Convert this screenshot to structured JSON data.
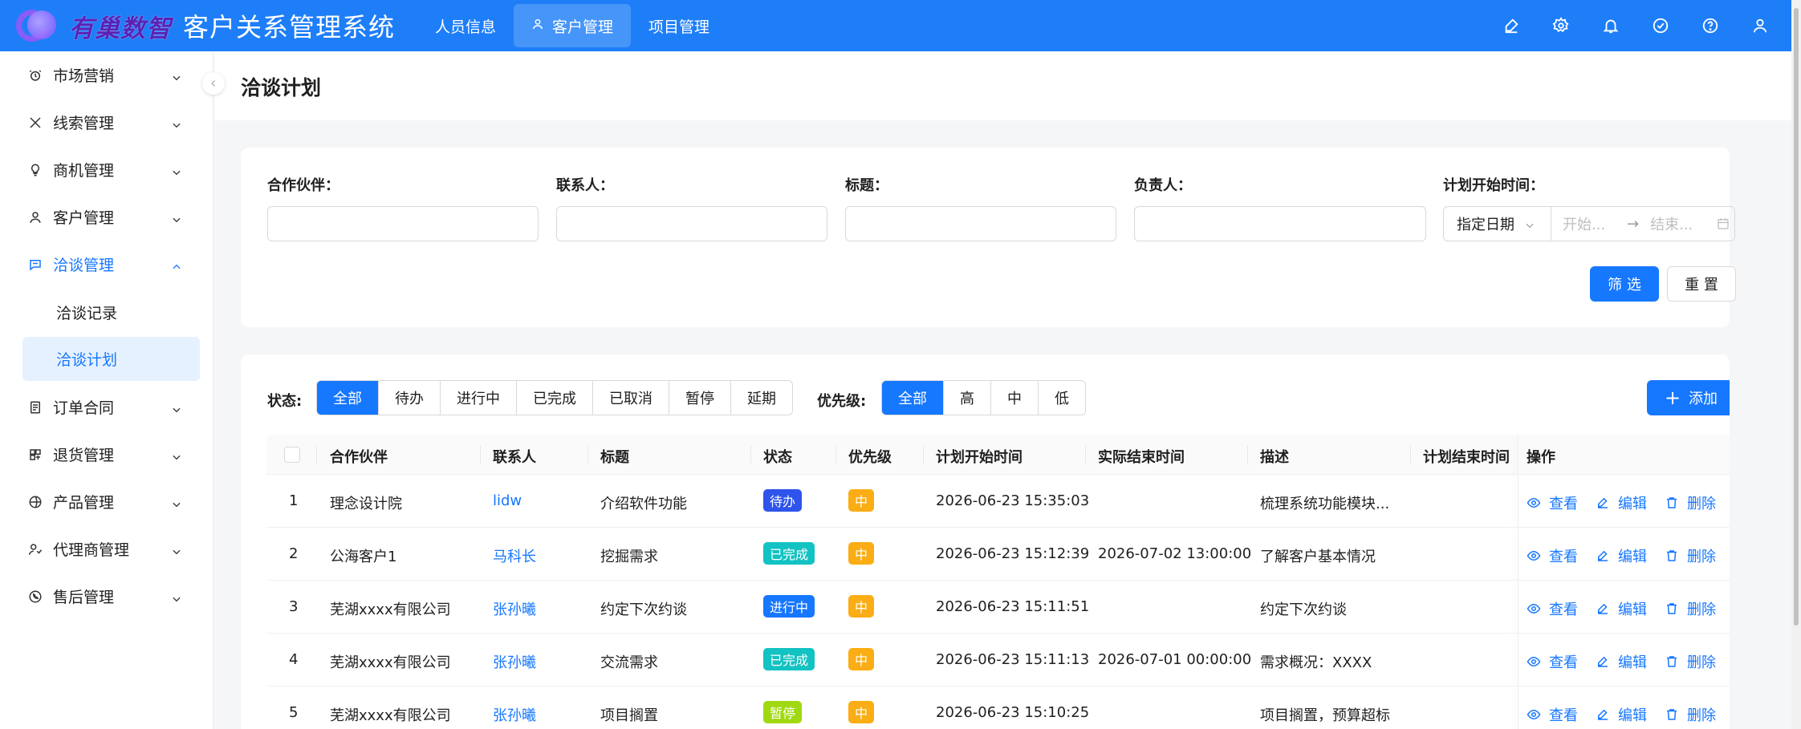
{
  "app": {
    "brand": "有巢数智",
    "title": "客户关系管理系统"
  },
  "topnav": [
    {
      "label": "人员信息",
      "icon": "",
      "active": false
    },
    {
      "label": "客户管理",
      "icon": "user-icon",
      "active": true
    },
    {
      "label": "项目管理",
      "icon": "",
      "active": false
    }
  ],
  "top_icons": [
    "brush-icon",
    "gear-icon",
    "bell-icon",
    "check-circle-icon",
    "help-icon",
    "user-icon"
  ],
  "sidebar": {
    "items": [
      {
        "label": "市场营销",
        "icon": "alarm-icon"
      },
      {
        "label": "线索管理",
        "icon": "x-icon"
      },
      {
        "label": "商机管理",
        "icon": "bulb-icon"
      },
      {
        "label": "客户管理",
        "icon": "user-icon"
      },
      {
        "label": "洽谈管理",
        "icon": "chat-icon",
        "open": true
      },
      {
        "label": "订单合同",
        "icon": "doc-icon"
      },
      {
        "label": "退货管理",
        "icon": "return-icon"
      },
      {
        "label": "产品管理",
        "icon": "product-icon"
      },
      {
        "label": "代理商管理",
        "icon": "agent-icon"
      },
      {
        "label": "售后管理",
        "icon": "phone-icon"
      }
    ],
    "sub_items": [
      {
        "label": "洽谈记录",
        "active": false
      },
      {
        "label": "洽谈计划",
        "active": true
      }
    ]
  },
  "page": {
    "title": "洽谈计划"
  },
  "filter": {
    "partner_label": "合作伙伴：",
    "contact_label": "联系人：",
    "title_label": "标题：",
    "owner_label": "负责人：",
    "start_time_label": "计划开始时间：",
    "date_mode": "指定日期",
    "start_placeholder": "开始...",
    "end_placeholder": "结束...",
    "arrow": "→",
    "submit": "筛 选",
    "reset": "重 置"
  },
  "toolbar": {
    "status_label": "状态:",
    "status_options": [
      "全部",
      "待办",
      "进行中",
      "已完成",
      "已取消",
      "暂停",
      "延期"
    ],
    "priority_label": "优先级:",
    "priority_options": [
      "全部",
      "高",
      "中",
      "低"
    ],
    "add_label": "添加"
  },
  "table": {
    "columns": [
      "合作伙伴",
      "联系人",
      "标题",
      "状态",
      "优先级",
      "计划开始时间",
      "实际结束时间",
      "描述",
      "计划结束时间",
      "操作"
    ],
    "ops": {
      "view": "查看",
      "edit": "编辑",
      "delete": "删除"
    },
    "rows": [
      {
        "no": "1",
        "partner": "理念设计院",
        "contact": "lidw",
        "title": "介绍软件功能",
        "status": "待办",
        "status_type": "todo",
        "priority": "中",
        "start": "2026-06-23 15:35:03",
        "actual_end": "",
        "desc": "梳理系统功能模块...",
        "plan_end": ""
      },
      {
        "no": "2",
        "partner": "公海客户1",
        "contact": "马科长",
        "title": "挖掘需求",
        "status": "已完成",
        "status_type": "done",
        "priority": "中",
        "start": "2026-06-23 15:12:39",
        "actual_end": "2026-07-02 13:00:00",
        "desc": "了解客户基本情况",
        "plan_end": ""
      },
      {
        "no": "3",
        "partner": "芜湖xxxx有限公司",
        "contact": "张孙曦",
        "title": "约定下次约谈",
        "status": "进行中",
        "status_type": "doing",
        "priority": "中",
        "start": "2026-06-23 15:11:51",
        "actual_end": "",
        "desc": "约定下次约谈",
        "plan_end": ""
      },
      {
        "no": "4",
        "partner": "芜湖xxxx有限公司",
        "contact": "张孙曦",
        "title": "交流需求",
        "status": "已完成",
        "status_type": "done",
        "priority": "中",
        "start": "2026-06-23 15:11:13",
        "actual_end": "2026-07-01 00:00:00",
        "desc": "需求概况：XXXX",
        "plan_end": ""
      },
      {
        "no": "5",
        "partner": "芜湖xxxx有限公司",
        "contact": "张孙曦",
        "title": "项目搁置",
        "status": "暂停",
        "status_type": "pause",
        "priority": "中",
        "start": "2026-06-23 15:10:25",
        "actual_end": "",
        "desc": "项目搁置，预算超标",
        "plan_end": ""
      }
    ]
  }
}
